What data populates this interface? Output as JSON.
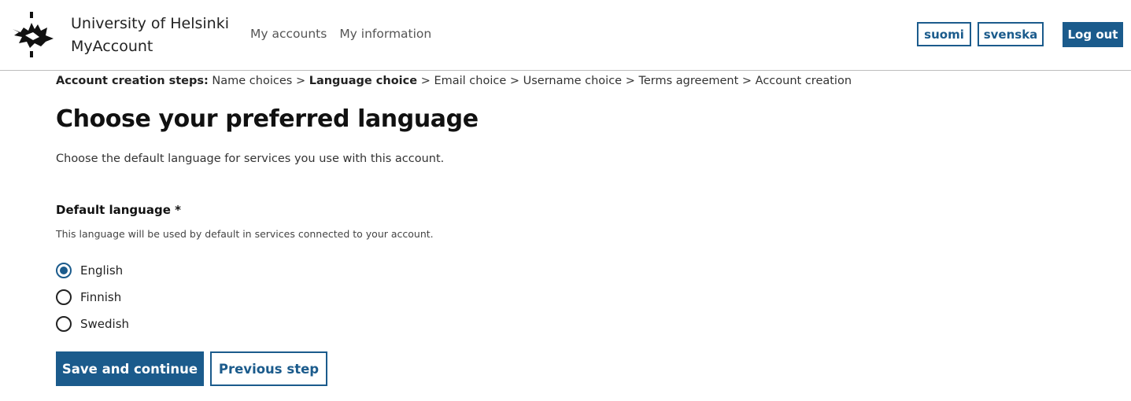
{
  "header": {
    "logo_icon": "university-flame-logo-icon",
    "brand_line1": "University of Helsinki",
    "brand_line2": "MyAccount",
    "nav": [
      "My accounts",
      "My information"
    ],
    "lang_fi": "suomi",
    "lang_sv": "svenska",
    "logout": "Log out"
  },
  "steps": {
    "label": "Account creation steps:",
    "items": [
      "Name choices",
      "Language choice",
      "Email choice",
      "Username choice",
      "Terms agreement",
      "Account creation"
    ],
    "current": "Language choice",
    "separator": ">"
  },
  "page": {
    "title": "Choose your preferred language",
    "description": "Choose the default language for services you use with this account."
  },
  "form": {
    "field_label": "Default language *",
    "hint": "This language will be used by default in services connected to your account.",
    "options": [
      {
        "label": "English",
        "selected": true
      },
      {
        "label": "Finnish",
        "selected": false
      },
      {
        "label": "Swedish",
        "selected": false
      }
    ]
  },
  "actions": {
    "save": "Save and continue",
    "previous": "Previous step"
  },
  "colors": {
    "accent": "#1b5b8c",
    "text": "#222222",
    "divider": "#bdbdbd"
  }
}
